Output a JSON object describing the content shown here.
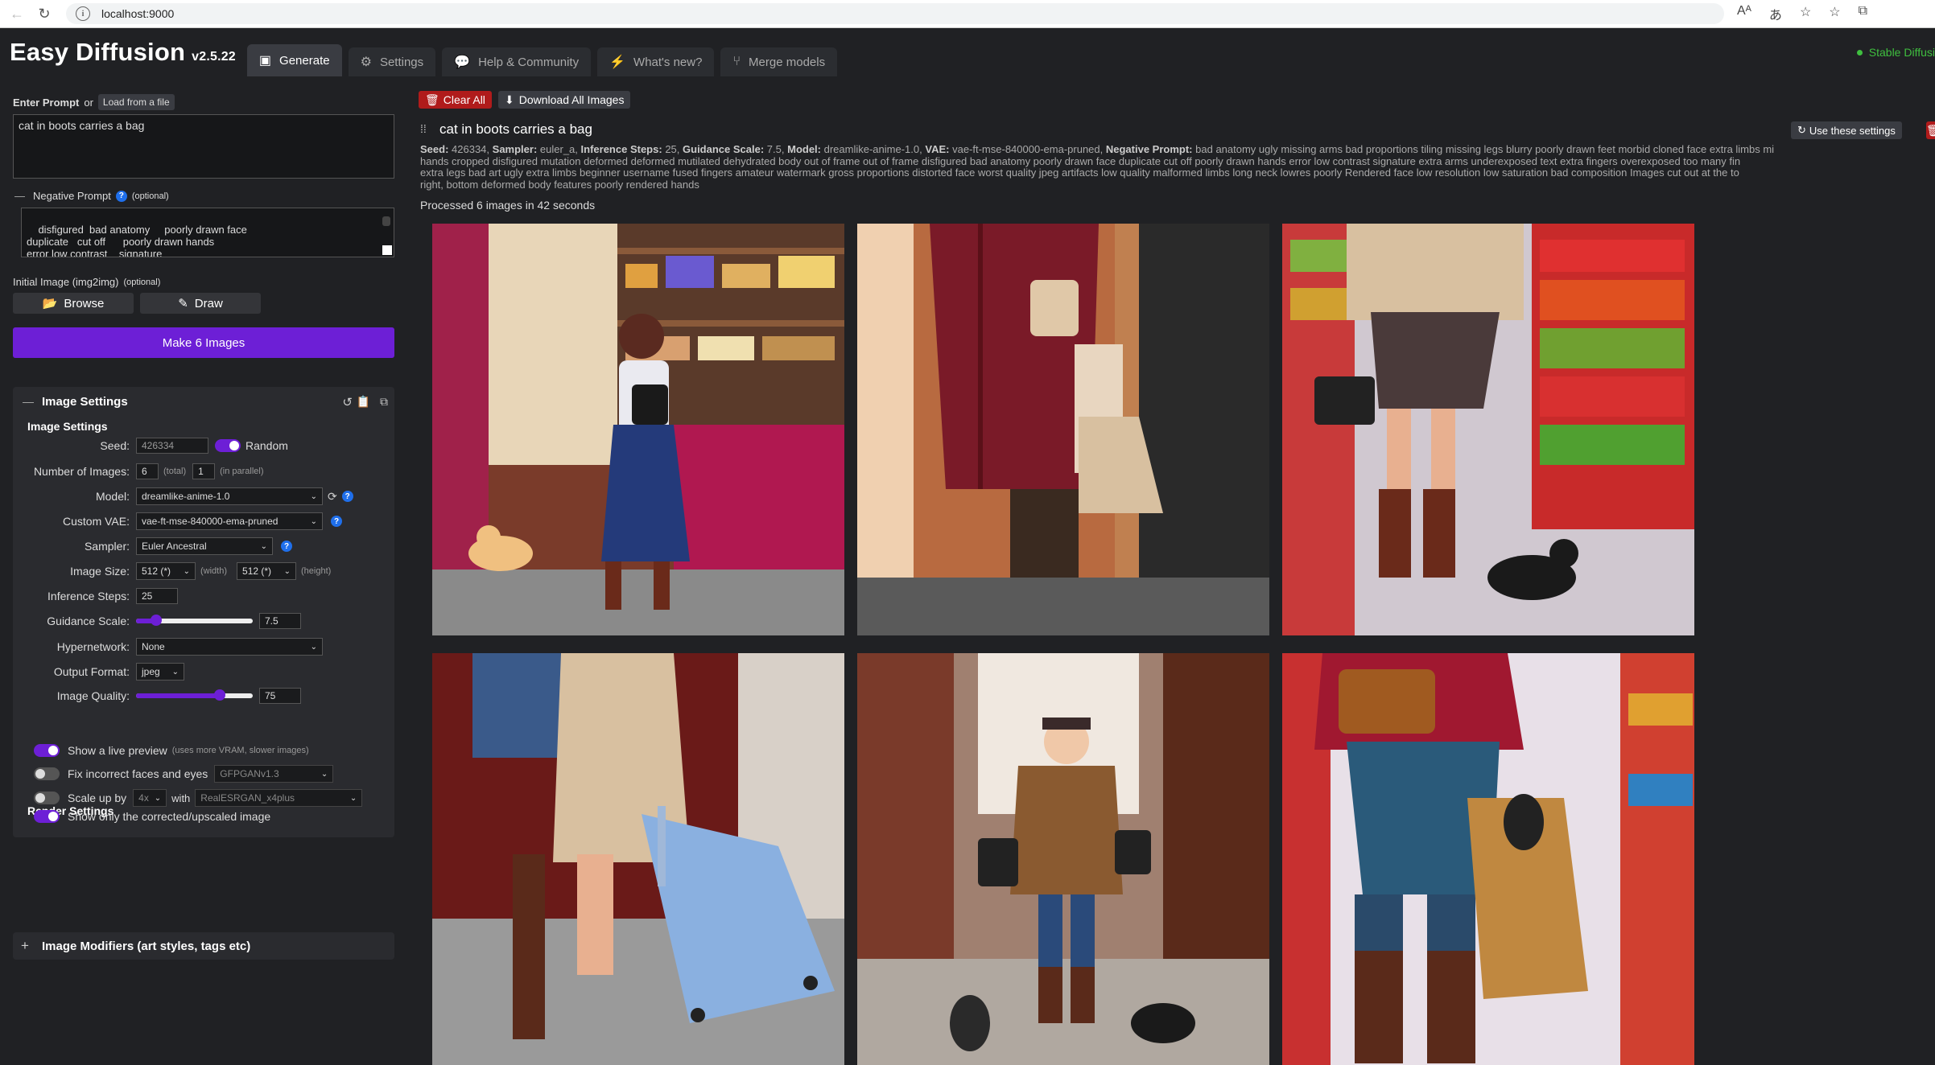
{
  "browser": {
    "url": "localhost:9000",
    "icons": [
      "read-aloud-icon",
      "translate-icon",
      "favorite-icon",
      "favorites-icon",
      "extensions-icon"
    ]
  },
  "app": {
    "title": "Easy Diffusion",
    "version": "v2.5.22",
    "status": "Stable Diffusi"
  },
  "tabs": [
    {
      "label": "Generate",
      "icon": "image-icon",
      "active": true
    },
    {
      "label": "Settings",
      "icon": "gear-icon"
    },
    {
      "label": "Help & Community",
      "icon": "comments-icon"
    },
    {
      "label": "What's new?",
      "icon": "bolt-icon"
    },
    {
      "label": "Merge models",
      "icon": "branch-icon"
    }
  ],
  "prompt": {
    "label": "Enter Prompt",
    "or": "or",
    "load_button": "Load from a file",
    "value": "cat in boots carries a bag"
  },
  "negative": {
    "toggle": "—",
    "label": "Negative Prompt",
    "optional": "(optional)",
    "value": "disfigured  bad anatomy     poorly drawn face\nduplicate   cut off      poorly drawn hands\nerror low contrast    signature\nextra arms underexposed    text"
  },
  "initial_image": {
    "label": "Initial Image (img2img)",
    "optional": "(optional)",
    "browse": "Browse",
    "draw": "Draw"
  },
  "make_button": "Make 6 Images",
  "image_settings": {
    "header": "Image Settings",
    "subheader": "Image Settings",
    "seed": {
      "label": "Seed:",
      "value": "426334",
      "random_label": "Random"
    },
    "num_images": {
      "label": "Number of Images:",
      "total": "6",
      "total_hint": "(total)",
      "parallel": "1",
      "parallel_hint": "(in parallel)"
    },
    "model": {
      "label": "Model:",
      "value": "dreamlike-anime-1.0"
    },
    "vae": {
      "label": "Custom VAE:",
      "value": "vae-ft-mse-840000-ema-pruned"
    },
    "sampler": {
      "label": "Sampler:",
      "value": "Euler Ancestral"
    },
    "size": {
      "label": "Image Size:",
      "width": "512 (*)",
      "width_hint": "(width)",
      "height": "512 (*)",
      "height_hint": "(height)"
    },
    "steps": {
      "label": "Inference Steps:",
      "value": "25"
    },
    "guidance": {
      "label": "Guidance Scale:",
      "value": "7.5",
      "fraction": 0.17
    },
    "hypernetwork": {
      "label": "Hypernetwork:",
      "value": "None"
    },
    "output_format": {
      "label": "Output Format:",
      "value": "jpeg"
    },
    "quality": {
      "label": "Image Quality:",
      "value": "75",
      "fraction": 0.72
    },
    "render_header": "Render Settings",
    "live_preview": {
      "label": "Show a live preview",
      "hint": "(uses more VRAM, slower images)",
      "on": true
    },
    "fix_faces": {
      "label": "Fix incorrect faces and eyes",
      "value": "GFPGANv1.3",
      "on": false
    },
    "upscale": {
      "label": "Scale up by",
      "factor": "4x",
      "with": "with",
      "value": "RealESRGAN_x4plus",
      "on": false
    },
    "upscaled_only": {
      "label": "Show only the corrected/upscaled image",
      "on": true
    }
  },
  "modifiers": {
    "label": "Image Modifiers (art styles, tags etc)",
    "toggle": "+"
  },
  "toolbar": {
    "clear_all": "Clear All",
    "download_all": "Download All Images"
  },
  "task": {
    "title": "cat in boots carries a bag",
    "use_settings": "Use these settings",
    "meta": {
      "seed_label": "Seed:",
      "seed": "426334,",
      "sampler_label": "Sampler:",
      "sampler": "euler_a,",
      "steps_label": "Inference Steps:",
      "steps": "25,",
      "guidance_label": "Guidance Scale:",
      "guidance": "7.5,",
      "model_label": "Model:",
      "model": "dreamlike-anime-1.0,",
      "vae_label": "VAE:",
      "vae": "vae-ft-mse-840000-ema-pruned,",
      "neg_label": "Negative Prompt:",
      "neg_line1": "bad anatomy ugly missing arms bad proportions tiling missing legs blurry poorly drawn feet morbid cloned face extra limbs mi",
      "neg_line2": "hands cropped disfigured mutation deformed deformed mutilated dehydrated body out of frame out of frame disfigured bad anatomy poorly drawn face duplicate cut off poorly drawn hands error low contrast signature extra arms underexposed text extra fingers overexposed too many fin",
      "neg_line3": "extra legs bad art ugly extra limbs beginner username fused fingers amateur watermark gross proportions distorted face worst quality jpeg artifacts low quality malformed limbs long neck lowres poorly Rendered face low resolution low saturation bad composition Images cut out at the to",
      "neg_line4": "right, bottom deformed body features poorly rendered hands"
    },
    "processed": "Processed 6 images in 42 seconds"
  },
  "images": [
    {
      "alt": "cat-in-boots-shop-girl"
    },
    {
      "alt": "coat-bag-boots"
    },
    {
      "alt": "supermarket-black-cat"
    },
    {
      "alt": "suitcase-boots"
    },
    {
      "alt": "street-cats"
    },
    {
      "alt": "shopping-bag-cat"
    }
  ]
}
